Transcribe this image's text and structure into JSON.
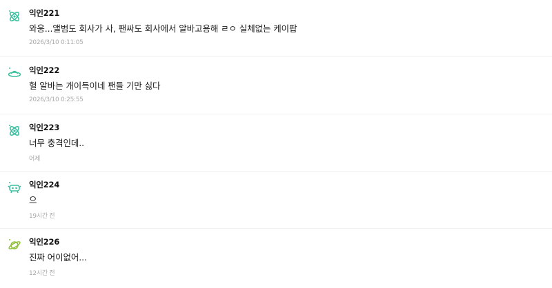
{
  "comments": [
    {
      "author": "익인221",
      "text": "와웅...앨범도 회사가 사, 팬싸도 회사에서 알바고용해 ㄹㅇ 실체없는 케이팝",
      "time": "2026/3/10 0:11:05",
      "icon": "atom-icon"
    },
    {
      "author": "익인222",
      "text": "헐 알바는 개이득이네 팬들 기만 싫다",
      "time": "2026/3/10 0:25:55",
      "icon": "ufo-icon"
    },
    {
      "author": "익인223",
      "text": "너무 충격인데..",
      "time": "어제",
      "icon": "atom-icon"
    },
    {
      "author": "익인224",
      "text": "으",
      "time": "19시간 전",
      "icon": "alien-icon"
    },
    {
      "author": "익인226",
      "text": "진짜 어이없어...",
      "time": "12시간 전",
      "icon": "planet-icon"
    }
  ],
  "colors": {
    "icon_teal": "#3cbfa0",
    "icon_green": "#8fbf3a"
  }
}
